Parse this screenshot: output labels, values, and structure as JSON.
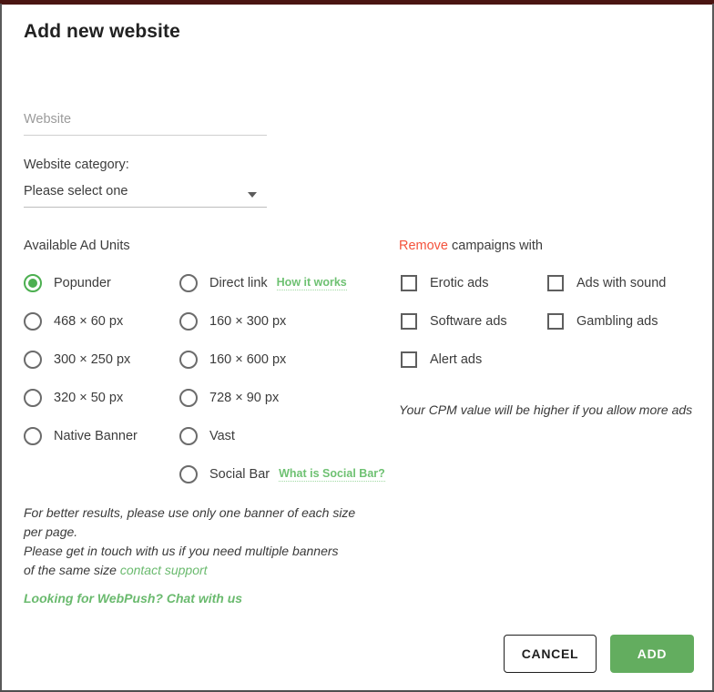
{
  "dialog": {
    "title": "Add new website"
  },
  "website_field": {
    "placeholder": "Website",
    "value": ""
  },
  "category": {
    "label": "Website category:",
    "selected": "Please select one",
    "caret_icon": "chevron-down-icon"
  },
  "ad_units": {
    "heading": "Available Ad Units",
    "left_column": [
      {
        "label": "Popunder",
        "selected": true
      },
      {
        "label": "468 × 60 px",
        "selected": false
      },
      {
        "label": "300 × 250 px",
        "selected": false
      },
      {
        "label": "320 × 50 px",
        "selected": false
      },
      {
        "label": "Native Banner",
        "selected": false
      }
    ],
    "right_column": [
      {
        "label": "Direct link",
        "selected": false,
        "link": "How it works"
      },
      {
        "label": "160 × 300 px",
        "selected": false
      },
      {
        "label": "160 × 600 px",
        "selected": false
      },
      {
        "label": "728 × 90 px",
        "selected": false
      },
      {
        "label": "Vast",
        "selected": false
      },
      {
        "label": "Social Bar",
        "selected": false,
        "link": "What is Social Bar?"
      }
    ]
  },
  "remove_campaigns": {
    "heading_accent": "Remove",
    "heading_rest": " campaigns with",
    "column_a": [
      {
        "label": "Erotic ads",
        "checked": false
      },
      {
        "label": "Software ads",
        "checked": false
      },
      {
        "label": "Alert ads",
        "checked": false
      }
    ],
    "column_b": [
      {
        "label": "Ads with sound",
        "checked": false
      },
      {
        "label": "Gambling ads",
        "checked": false
      }
    ],
    "cpm_note": "Your CPM value will be higher if you allow more ads"
  },
  "notes": {
    "banner_note_line1": "For better results, please use only one banner of each size",
    "banner_note_line2": "per page.",
    "banner_note_line3": "Please get in touch with us if you need multiple banners",
    "banner_note_line4": "of the same size ",
    "contact_link": "contact support",
    "webpush_link": "Looking for WebPush? Chat with us"
  },
  "footer": {
    "cancel_label": "CANCEL",
    "add_label": "ADD"
  },
  "colors": {
    "accent_green": "#63ad5f",
    "link_green": "#6aba6e",
    "accent_red": "#f4523c",
    "text": "#3c3c3c",
    "backdrop": "#4a1512"
  }
}
